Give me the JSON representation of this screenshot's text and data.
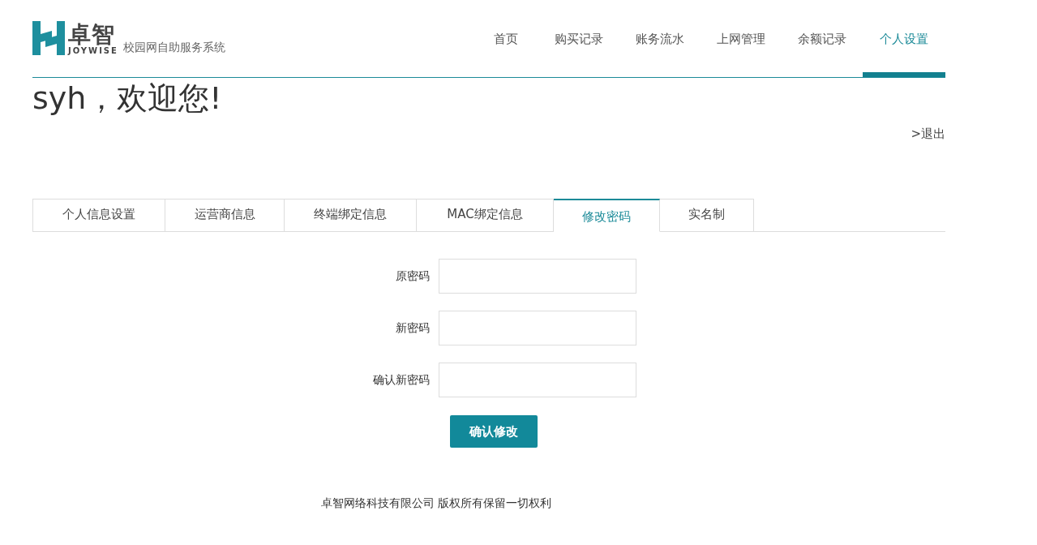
{
  "logo": {
    "brand": "卓智",
    "latin": "JOYWISE",
    "system": "校园网自助服务系统"
  },
  "nav": [
    {
      "label": "首页",
      "selected": false
    },
    {
      "label": "购买记录",
      "selected": false
    },
    {
      "label": "账务流水",
      "selected": false
    },
    {
      "label": "上网管理",
      "selected": false
    },
    {
      "label": "余额记录",
      "selected": false
    },
    {
      "label": "个人设置",
      "selected": true
    }
  ],
  "welcome": "syh，欢迎您!",
  "logout": ">退出",
  "tabs": [
    {
      "label": "个人信息设置",
      "selected": false
    },
    {
      "label": "运营商信息",
      "selected": false
    },
    {
      "label": "终端绑定信息",
      "selected": false
    },
    {
      "label": "MAC绑定信息",
      "selected": false
    },
    {
      "label": "修改密码",
      "selected": true
    },
    {
      "label": "实名制",
      "selected": false
    }
  ],
  "form": {
    "fields": [
      {
        "label": "原密码"
      },
      {
        "label": "新密码"
      },
      {
        "label": "确认新密码"
      }
    ],
    "submit": "确认修改"
  },
  "footer": "卓智网络科技有限公司 版权所有保留一切权利"
}
